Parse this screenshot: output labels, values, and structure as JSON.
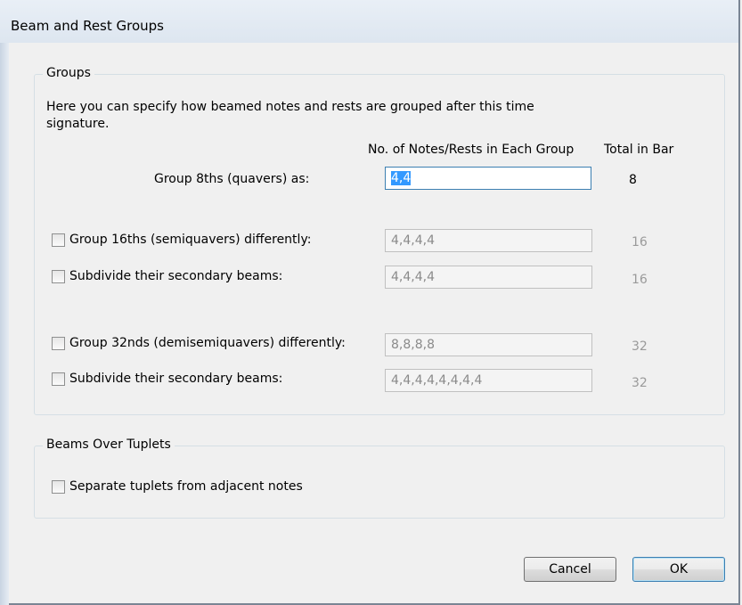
{
  "window": {
    "title": "Beam and Rest Groups"
  },
  "groups": {
    "legend": "Groups",
    "description": "Here you can specify how beamed notes and rests are grouped after this time signature.",
    "description_line1": "Here you can specify how beamed notes and rests are grouped after this time",
    "description_line2": "signature.",
    "col_notes_header": "No. of Notes/Rests in Each Group",
    "col_total_header": "Total in Bar",
    "rows": [
      {
        "label": "Group 8ths (quavers) as:",
        "value": "4,4",
        "total": "8",
        "has_checkbox": false,
        "checked": false,
        "enabled": true
      },
      {
        "label": "Group 16ths (semiquavers) differently:",
        "value": "4,4,4,4",
        "total": "16",
        "has_checkbox": true,
        "checked": false,
        "enabled": false
      },
      {
        "label": "Subdivide their secondary beams:",
        "value": "4,4,4,4",
        "total": "16",
        "has_checkbox": true,
        "checked": false,
        "enabled": false
      },
      {
        "label": "Group 32nds (demisemiquavers) differently:",
        "value": "8,8,8,8",
        "total": "32",
        "has_checkbox": true,
        "checked": false,
        "enabled": false
      },
      {
        "label": "Subdivide their secondary beams:",
        "value": "4,4,4,4,4,4,4,4",
        "total": "32",
        "has_checkbox": true,
        "checked": false,
        "enabled": false
      }
    ]
  },
  "tuplets": {
    "legend": "Beams Over Tuplets",
    "separate_label": "Separate tuplets from adjacent notes",
    "separate_checked": false
  },
  "buttons": {
    "cancel": "Cancel",
    "ok": "OK"
  }
}
